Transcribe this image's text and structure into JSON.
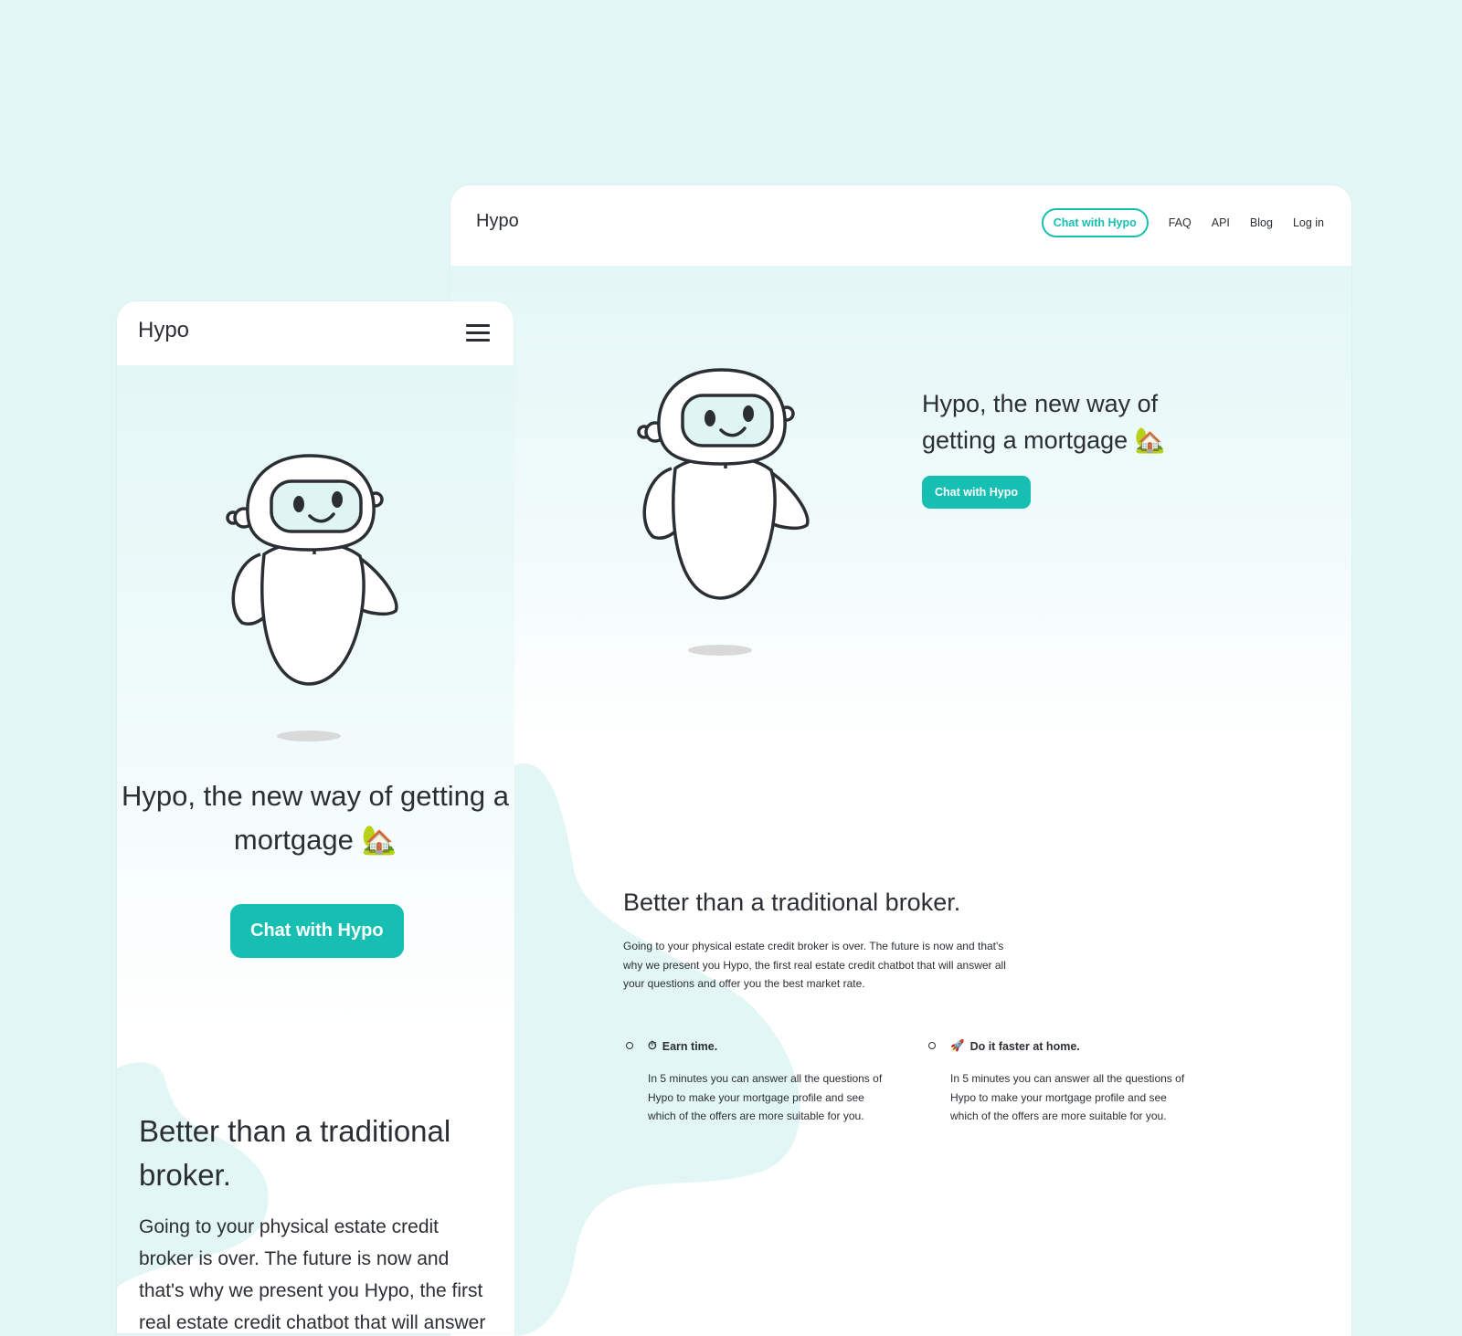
{
  "desktop": {
    "logo": "Hypo",
    "nav": {
      "cta": "Chat with Hypo",
      "links": [
        "FAQ",
        "API",
        "Blog",
        "Log in"
      ]
    },
    "hero": {
      "headline": "Hypo, the new way of getting a mortgage 🏡",
      "cta": "Chat with Hypo"
    },
    "section": {
      "title": "Better than a traditional broker.",
      "text": "Going to your physical estate credit broker is over. The future is now and that's why we present you Hypo, the first real estate credit chatbot that will answer all your questions and offer you the best market rate."
    },
    "features": [
      {
        "icon": "⏱",
        "title": "Earn time.",
        "text": "In 5 minutes you can answer all the questions of Hypo to make your mortgage profile and see which of the offers are more suitable for you."
      },
      {
        "icon": "🚀",
        "title": "Do it faster at home.",
        "text": "In 5 minutes you can answer all the questions of Hypo to make your mortgage profile and see which of the offers are more suitable for you."
      }
    ]
  },
  "mobile": {
    "logo": "Hypo",
    "hero": {
      "headline": "Hypo, the new way of getting a mortgage 🏡",
      "cta": "Chat with Hypo"
    },
    "section": {
      "title": "Better than a traditional broker.",
      "text": "Going to your physical estate credit broker is over. The future is now and that's why we present you Hypo, the first real estate credit chatbot that will answer all your questions and offer you the best market rate."
    }
  },
  "colors": {
    "background": "#e2f6f5",
    "accent": "#16bfb2",
    "text": "#2b2f33",
    "blob": "#e2f6f5"
  },
  "icons": {
    "menu": "hamburger-icon",
    "robot": "robot-mascot-illustration"
  }
}
